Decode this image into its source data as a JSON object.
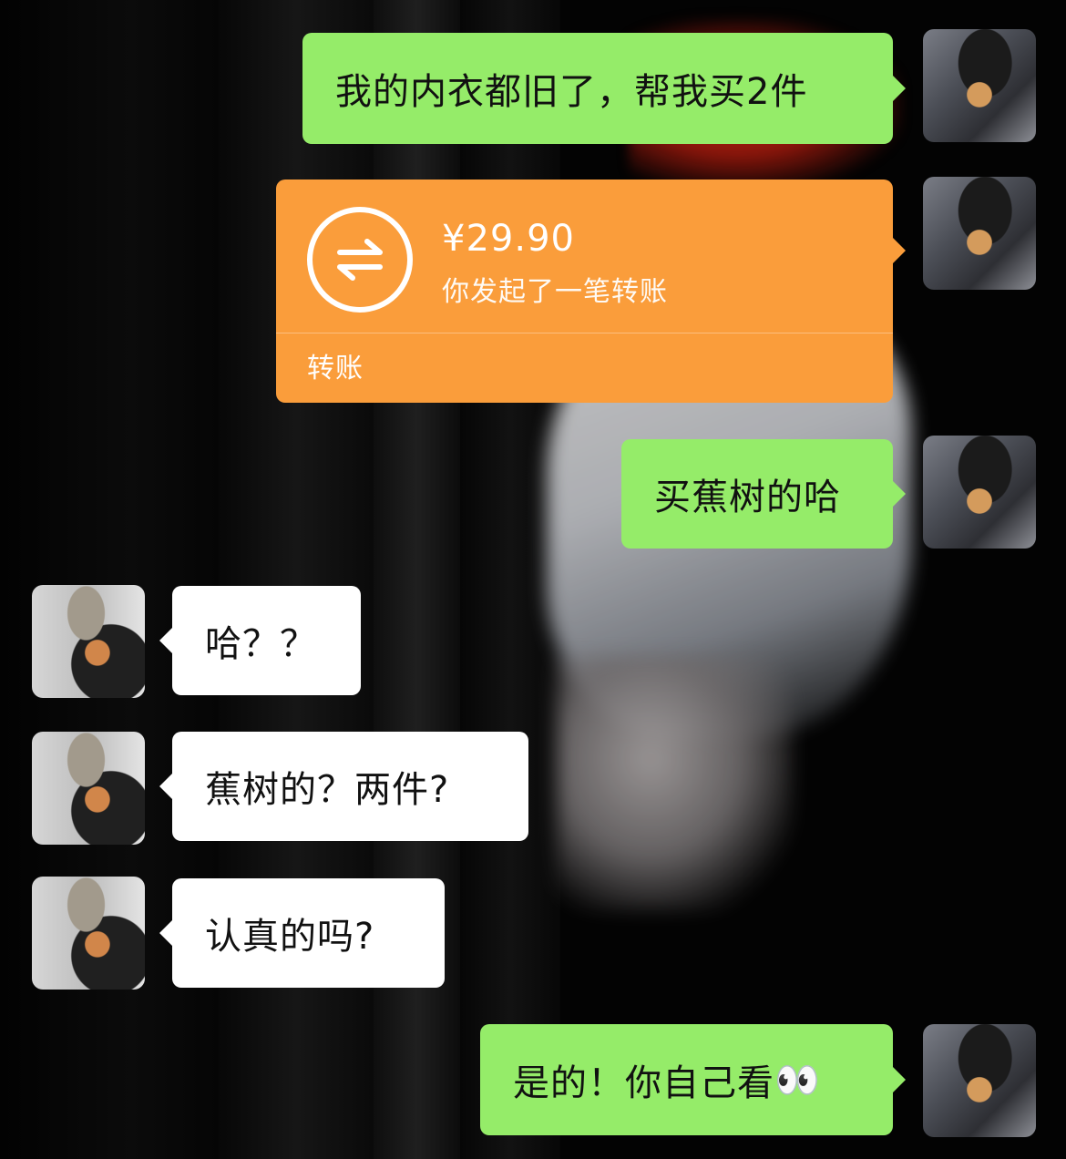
{
  "conversation": {
    "messages": [
      {
        "sender": "me",
        "type": "text",
        "text": "我的内衣都旧了，帮我买2件"
      },
      {
        "sender": "me",
        "type": "transfer",
        "amount": "¥29.90",
        "description": "你发起了一笔转账",
        "label": "转账"
      },
      {
        "sender": "me",
        "type": "text",
        "text": "买蕉树的哈"
      },
      {
        "sender": "other",
        "type": "text",
        "text": "哈？？"
      },
      {
        "sender": "other",
        "type": "text",
        "text": "蕉树的？两件?"
      },
      {
        "sender": "other",
        "type": "text",
        "text": "认真的吗?"
      },
      {
        "sender": "me",
        "type": "text",
        "text": "是的！你自己看",
        "emoji": "👀"
      }
    ]
  },
  "colors": {
    "outgoing_bubble": "#95ec69",
    "incoming_bubble": "#ffffff",
    "transfer_bubble": "#fa9d3b"
  },
  "icons": {
    "transfer": "transfer-arrows-icon",
    "avatar_me": "avatar-girl-with-cat",
    "avatar_other": "avatar-boy-with-cat"
  }
}
